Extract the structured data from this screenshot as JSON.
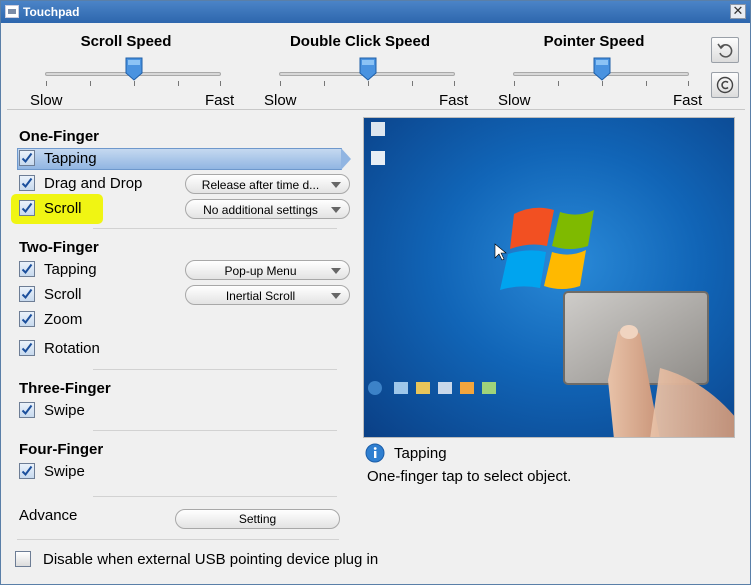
{
  "window": {
    "title": "Touchpad",
    "close_glyph": "✕"
  },
  "speeds": [
    {
      "label": "Scroll Speed",
      "slow": "Slow",
      "fast": "Fast"
    },
    {
      "label": "Double Click Speed",
      "slow": "Slow",
      "fast": "Fast"
    },
    {
      "label": "Pointer Speed",
      "slow": "Slow",
      "fast": "Fast"
    }
  ],
  "side_buttons": [
    "undo-icon",
    "copyright-icon"
  ],
  "groups": {
    "one_finger": {
      "title": "One-Finger",
      "items": [
        {
          "label": "Tapping",
          "checked": true
        },
        {
          "label": "Drag and Drop",
          "checked": true,
          "option": "Release after time d..."
        },
        {
          "label": "Scroll",
          "checked": true,
          "option": "No additional settings"
        }
      ]
    },
    "two_finger": {
      "title": "Two-Finger",
      "items": [
        {
          "label": "Tapping",
          "checked": true,
          "option": "Pop-up Menu"
        },
        {
          "label": "Scroll",
          "checked": true,
          "option": "Inertial Scroll"
        },
        {
          "label": "Zoom",
          "checked": true
        },
        {
          "label": "Rotation",
          "checked": true
        }
      ]
    },
    "three_finger": {
      "title": "Three-Finger",
      "items": [
        {
          "label": "Swipe",
          "checked": true
        }
      ]
    },
    "four_finger": {
      "title": "Four-Finger",
      "items": [
        {
          "label": "Swipe",
          "checked": true
        }
      ]
    }
  },
  "advance": {
    "label": "Advance",
    "button": "Setting"
  },
  "usb": {
    "label": "Disable when external USB pointing device plug in",
    "checked": false
  },
  "info": {
    "title": "Tapping",
    "description": "One-finger tap to select object."
  },
  "colors": {
    "title_bar": "#2d66ad",
    "selection": "#91b5e2",
    "highlight": "#f0f500",
    "checkbox_check": "#1b4f9c"
  }
}
